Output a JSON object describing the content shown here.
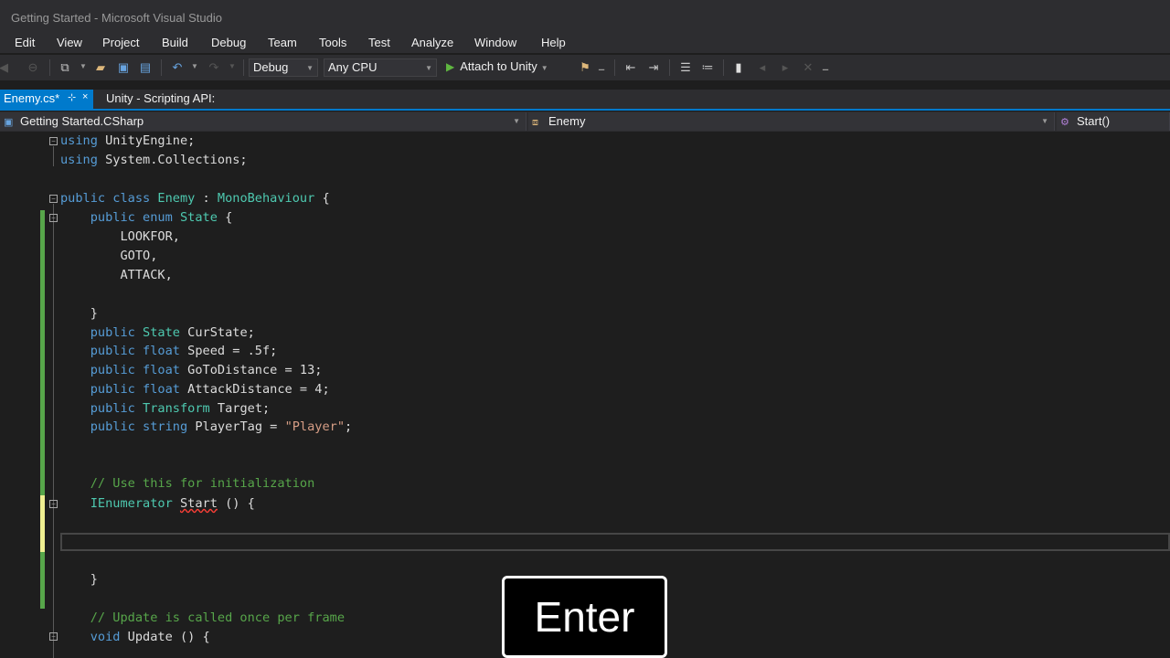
{
  "window": {
    "title": "Getting Started - Microsoft Visual Studio"
  },
  "menu": {
    "items": [
      "Edit",
      "View",
      "Project",
      "Build",
      "Debug",
      "Team",
      "Tools",
      "Test",
      "Analyze",
      "Window",
      "Help"
    ]
  },
  "toolbar": {
    "configuration": "Debug",
    "platform": "Any CPU",
    "attach_label": "Attach to Unity",
    "icons": [
      "back-icon",
      "forward-icon",
      "new-project-icon",
      "open-file-icon",
      "save-icon",
      "save-all-icon",
      "undo-icon",
      "redo-icon",
      "find-in-files-icon",
      "indent-icon",
      "outdent-icon",
      "comment-icon",
      "uncomment-icon",
      "bookmark-icon",
      "prev-bookmark-icon",
      "next-bookmark-icon",
      "clear-bookmarks-icon"
    ]
  },
  "tabs": [
    {
      "label": "Enemy.cs*",
      "active": true,
      "pin": "⊹",
      "close": "×"
    },
    {
      "label": "Unity - Scripting API:",
      "active": false
    }
  ],
  "navbar": {
    "project": "Getting Started.CSharp",
    "type": "Enemy",
    "member": "Start()"
  },
  "code": {
    "lines": [
      {
        "tokens": [
          {
            "t": "kw",
            "v": "using"
          },
          {
            "t": "",
            "v": " UnityEngine;"
          }
        ]
      },
      {
        "tokens": [
          {
            "t": "kw",
            "v": "using"
          },
          {
            "t": "",
            "v": " System.Collections;"
          }
        ]
      },
      {
        "tokens": []
      },
      {
        "tokens": [
          {
            "t": "kw",
            "v": "public"
          },
          {
            "t": "",
            "v": " "
          },
          {
            "t": "kw",
            "v": "class"
          },
          {
            "t": "",
            "v": " "
          },
          {
            "t": "ty",
            "v": "Enemy"
          },
          {
            "t": "",
            "v": " : "
          },
          {
            "t": "ty",
            "v": "MonoBehaviour"
          },
          {
            "t": "",
            "v": " {"
          }
        ]
      },
      {
        "tokens": [
          {
            "t": "",
            "v": "    "
          },
          {
            "t": "kw",
            "v": "public"
          },
          {
            "t": "",
            "v": " "
          },
          {
            "t": "kw",
            "v": "enum"
          },
          {
            "t": "",
            "v": " "
          },
          {
            "t": "ty",
            "v": "State"
          },
          {
            "t": "",
            "v": " {"
          }
        ]
      },
      {
        "tokens": [
          {
            "t": "",
            "v": "        LOOKFOR,"
          }
        ]
      },
      {
        "tokens": [
          {
            "t": "",
            "v": "        GOTO,"
          }
        ]
      },
      {
        "tokens": [
          {
            "t": "",
            "v": "        ATTACK,"
          }
        ]
      },
      {
        "tokens": []
      },
      {
        "tokens": [
          {
            "t": "",
            "v": "    }"
          }
        ]
      },
      {
        "tokens": [
          {
            "t": "",
            "v": "    "
          },
          {
            "t": "kw",
            "v": "public"
          },
          {
            "t": "",
            "v": " "
          },
          {
            "t": "ty",
            "v": "State"
          },
          {
            "t": "",
            "v": " CurState;"
          }
        ]
      },
      {
        "tokens": [
          {
            "t": "",
            "v": "    "
          },
          {
            "t": "kw",
            "v": "public"
          },
          {
            "t": "",
            "v": " "
          },
          {
            "t": "kw",
            "v": "float"
          },
          {
            "t": "",
            "v": " Speed = .5f;"
          }
        ]
      },
      {
        "tokens": [
          {
            "t": "",
            "v": "    "
          },
          {
            "t": "kw",
            "v": "public"
          },
          {
            "t": "",
            "v": " "
          },
          {
            "t": "kw",
            "v": "float"
          },
          {
            "t": "",
            "v": " GoToDistance = 13;"
          }
        ]
      },
      {
        "tokens": [
          {
            "t": "",
            "v": "    "
          },
          {
            "t": "kw",
            "v": "public"
          },
          {
            "t": "",
            "v": " "
          },
          {
            "t": "kw",
            "v": "float"
          },
          {
            "t": "",
            "v": " AttackDistance = 4;"
          }
        ]
      },
      {
        "tokens": [
          {
            "t": "",
            "v": "    "
          },
          {
            "t": "kw",
            "v": "public"
          },
          {
            "t": "",
            "v": " "
          },
          {
            "t": "ty",
            "v": "Transform"
          },
          {
            "t": "",
            "v": " Target;"
          }
        ]
      },
      {
        "tokens": [
          {
            "t": "",
            "v": "    "
          },
          {
            "t": "kw",
            "v": "public"
          },
          {
            "t": "",
            "v": " "
          },
          {
            "t": "kw",
            "v": "string"
          },
          {
            "t": "",
            "v": " PlayerTag = "
          },
          {
            "t": "st",
            "v": "\"Player\""
          },
          {
            "t": "",
            "v": ";"
          }
        ]
      },
      {
        "tokens": []
      },
      {
        "tokens": []
      },
      {
        "tokens": [
          {
            "t": "",
            "v": "    "
          },
          {
            "t": "cm",
            "v": "// Use this for initialization"
          }
        ]
      },
      {
        "tokens": [
          {
            "t": "",
            "v": "    "
          },
          {
            "t": "ty",
            "v": "IEnumerator"
          },
          {
            "t": "",
            "v": " "
          },
          {
            "t": "squig",
            "v": "Start"
          },
          {
            "t": "",
            "v": " () {"
          }
        ]
      },
      {
        "tokens": []
      },
      {
        "tokens": []
      },
      {
        "tokens": []
      },
      {
        "tokens": [
          {
            "t": "",
            "v": "    }"
          }
        ]
      },
      {
        "tokens": []
      },
      {
        "tokens": [
          {
            "t": "",
            "v": "    "
          },
          {
            "t": "cm",
            "v": "// Update is called once per frame"
          }
        ]
      },
      {
        "tokens": [
          {
            "t": "",
            "v": "    "
          },
          {
            "t": "kw",
            "v": "void"
          },
          {
            "t": "",
            "v": " Update () {"
          }
        ]
      }
    ]
  },
  "keystroke_overlay": {
    "label": "Enter"
  }
}
